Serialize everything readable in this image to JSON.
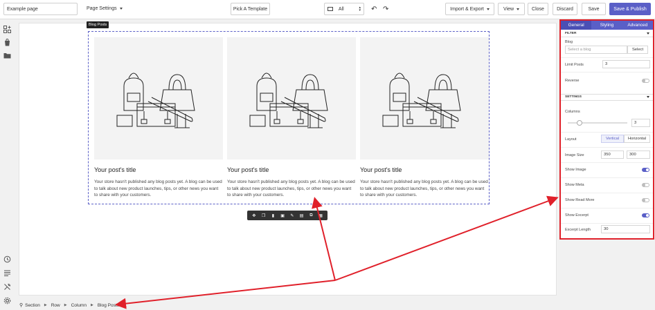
{
  "topbar": {
    "page_name_value": "Example page",
    "page_settings_label": "Page Settings",
    "pick_template_label": "Pick A Template",
    "device_label": "All",
    "import_export_label": "Import & Export",
    "view_label": "View",
    "close_label": "Close",
    "discard_label": "Discard",
    "save_label": "Save",
    "save_publish_label": "Save & Publish"
  },
  "canvas": {
    "section_label": "Blog Posts",
    "posts": [
      {
        "title": "Your post's title",
        "text": "Your store hasn't published any blog posts yet. A blog can be used to talk about new product launches, tips, or other news you want to share with your customers."
      },
      {
        "title": "Your post's title",
        "text": "Your store hasn't published any blog posts yet. A blog can be used to talk about new product launches, tips, or other news you want to share with your customers."
      },
      {
        "title": "Your post's title",
        "text": "Your store hasn't published any blog posts yet. A blog can be used to talk about new product launches, tips, or other news you want to share with your customers."
      }
    ]
  },
  "breadcrumb": {
    "items": [
      "Section",
      "Row",
      "Column",
      "Blog Posts"
    ]
  },
  "panel": {
    "tabs": [
      "General",
      "Styling",
      "Advanced"
    ],
    "filter_heading": "FILTER",
    "blog_label": "Blog",
    "blog_placeholder": "Select a blog",
    "select_button": "Select",
    "limit_posts_label": "Limit Posts",
    "limit_posts_value": "3",
    "reverse_label": "Reverse",
    "reverse_on": false,
    "settings_heading": "SETTINGS",
    "columns_label": "Columns",
    "columns_value": "3",
    "columns_slider_fraction": 0.2,
    "layout_label": "Layout",
    "layout_options": [
      "Vertical",
      "Horizontal"
    ],
    "layout_selected": "Vertical",
    "image_size_label": "Image Size",
    "image_width": "350",
    "image_height": "300",
    "show_image_label": "Show Image",
    "show_image_on": true,
    "show_meta_label": "Show Meta",
    "show_meta_on": false,
    "show_read_more_label": "Show Read More",
    "show_read_more_on": false,
    "show_excerpt_label": "Show Excerpt",
    "show_excerpt_on": true,
    "excerpt_length_label": "Excerpt Length",
    "excerpt_length_value": "30"
  },
  "colors": {
    "accent": "#5a5fc7",
    "annotation": "#e0202a"
  }
}
